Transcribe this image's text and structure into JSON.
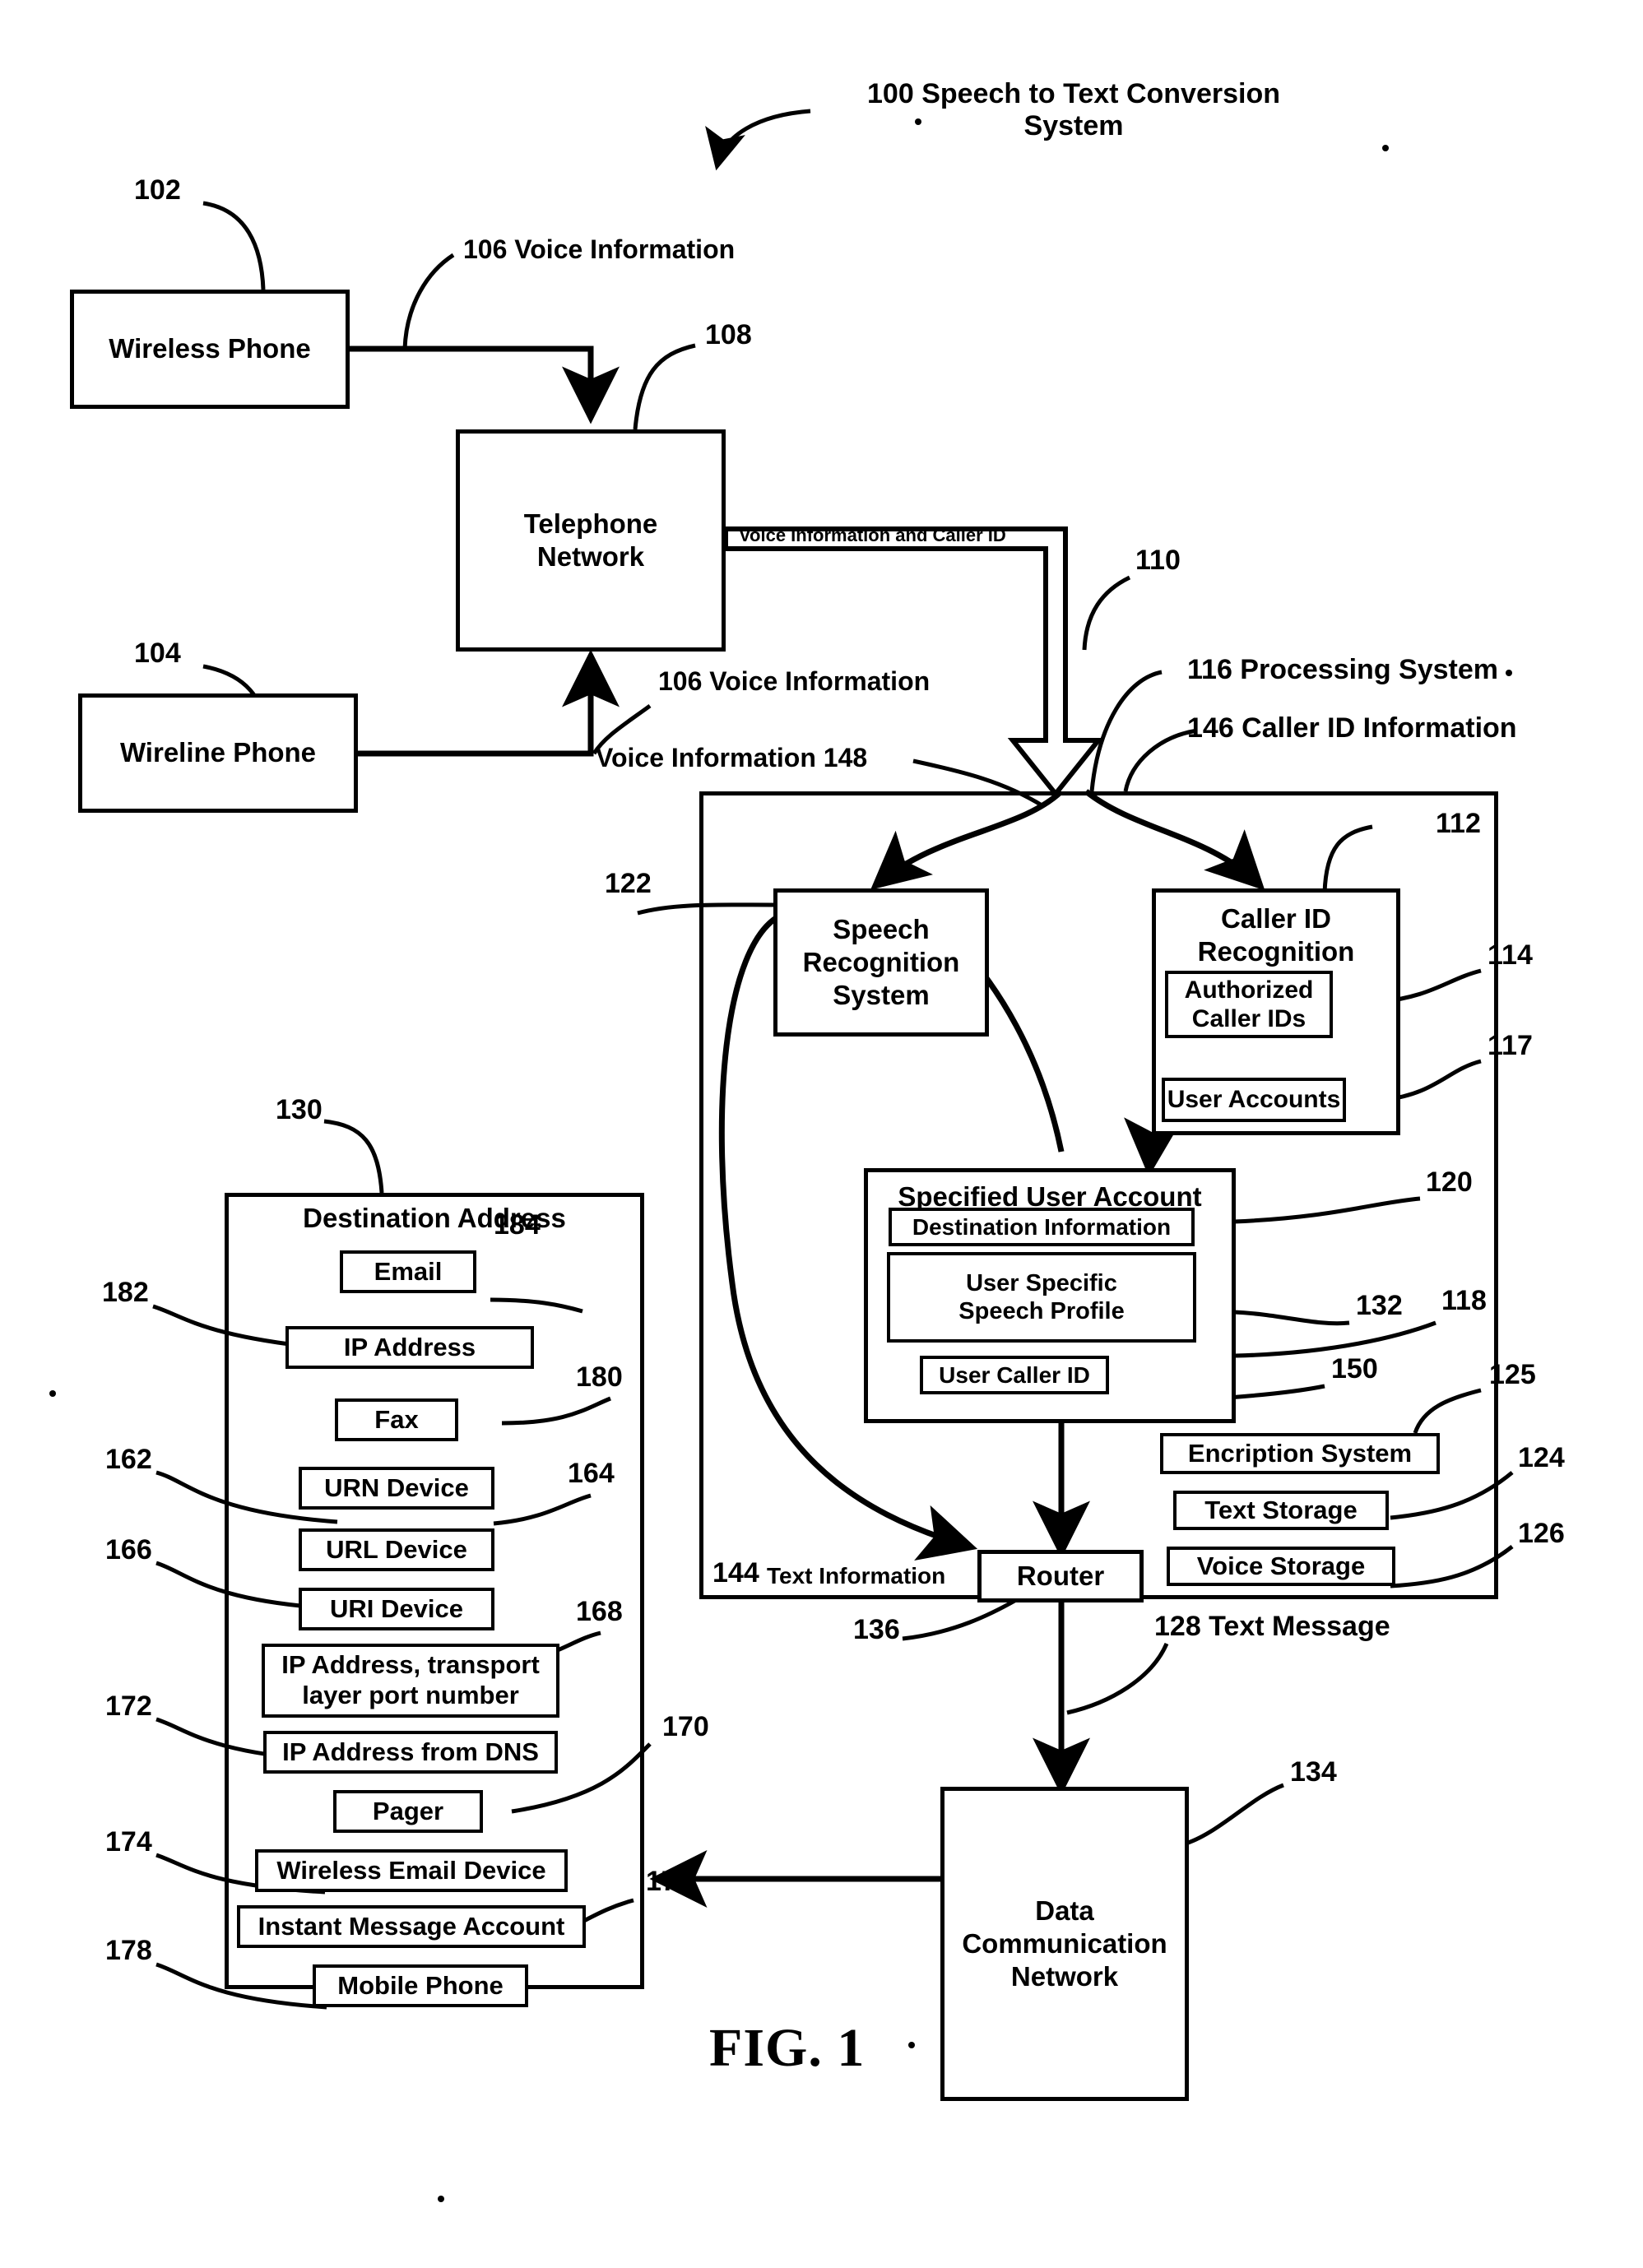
{
  "figure": {
    "caption": "FIG. 1",
    "title_line1": "100 Speech to Text Conversion",
    "title_line2": "System"
  },
  "nodes": {
    "wireless_phone": {
      "label": "Wireless Phone",
      "ref": "102"
    },
    "wireline_phone": {
      "label": "Wireline Phone",
      "ref": "104"
    },
    "telephone_network": {
      "line1": "Telephone",
      "line2": "Network",
      "ref": "108"
    },
    "speech_recognition": {
      "line1": "Speech",
      "line2": "Recognition",
      "line3": "System",
      "ref": "122"
    },
    "caller_id_recognition": {
      "line1": "Caller ID",
      "line2": "Recognition",
      "ref": "112"
    },
    "authorized_caller_ids": {
      "line1": "Authorized",
      "line2": "Caller IDs",
      "ref": "114"
    },
    "user_accounts": {
      "label": "User Accounts",
      "ref": "117"
    },
    "specified_user_account": {
      "title": "Specified User Account",
      "ref": "118"
    },
    "destination_information": {
      "label": "Destination Information",
      "ref": "120"
    },
    "user_specific_speech_profile": {
      "line1": "User Specific",
      "line2": "Speech Profile",
      "ref": "132"
    },
    "user_caller_id": {
      "label": "User Caller ID",
      "ref": "150"
    },
    "encription_system": {
      "label": "Encription System",
      "ref": "125"
    },
    "text_storage": {
      "label": "Text Storage",
      "ref": "124"
    },
    "voice_storage": {
      "label": "Voice Storage",
      "ref": "126"
    },
    "router": {
      "label": "Router",
      "ref": "136"
    },
    "data_communication_network": {
      "line1": "Data",
      "line2": "Communication",
      "line3": "Network",
      "ref": "134"
    },
    "processing_system": {
      "ref": "116",
      "label": "116 Processing System"
    },
    "destination_address": {
      "title": "Destination Address",
      "ref": "130"
    }
  },
  "destination_items": [
    {
      "label": "Email",
      "ref": "184"
    },
    {
      "label": "IP Address",
      "ref": "182"
    },
    {
      "label": "Fax",
      "ref": "180"
    },
    {
      "label": "URN Device",
      "ref": "162"
    },
    {
      "label": "URL Device",
      "ref": "164"
    },
    {
      "label": "URI Device",
      "ref": "166"
    },
    {
      "line1": "IP Address, transport",
      "line2": "layer port number",
      "ref": "168"
    },
    {
      "label": "IP Address from DNS",
      "ref": "172"
    },
    {
      "label": "Pager",
      "ref": "170"
    },
    {
      "label": "Wireless Email Device",
      "ref": "174"
    },
    {
      "label": "Instant Message Account",
      "ref": "176"
    },
    {
      "label": "Mobile Phone",
      "ref": "178"
    }
  ],
  "flow_labels": {
    "voice_info_wireless": "106 Voice Information",
    "voice_info_wireline": "106 Voice Information",
    "voice_and_callerid": "Voice Information and Caller ID",
    "link_110": "110",
    "voice_information_148": "Voice Information 148",
    "caller_id_info_146": "146 Caller ID Information",
    "processing_system_116": "116 Processing System",
    "text_information_144_num": "144",
    "text_information_144_text": "Text Information",
    "text_message_128": "128 Text Message"
  },
  "ref_numbers": {
    "n100": "100",
    "n102": "102",
    "n104": "104",
    "n108": "108",
    "n110": "110",
    "n112": "112",
    "n114": "114",
    "n117": "117",
    "n118": "118",
    "n120": "120",
    "n122": "122",
    "n124": "124",
    "n125": "125",
    "n126": "126",
    "n130": "130",
    "n132": "132",
    "n134": "134",
    "n136": "136",
    "n150": "150",
    "n162": "162",
    "n164": "164",
    "n166": "166",
    "n168": "168",
    "n170": "170",
    "n172": "172",
    "n174": "174",
    "n176": "176",
    "n178": "178",
    "n180": "180",
    "n182": "182",
    "n184": "184"
  },
  "colors": {
    "ink": "#000000",
    "paper": "#ffffff"
  }
}
